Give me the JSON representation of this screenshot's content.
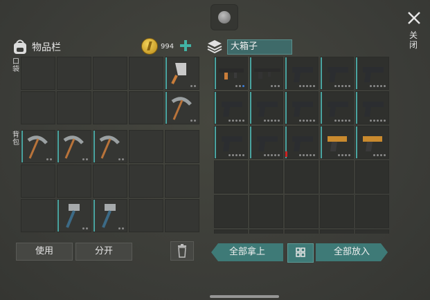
{
  "inventory": {
    "title": "物品栏",
    "coins": "994",
    "pocket_label": "口袋",
    "backpack_label": "背包"
  },
  "box": {
    "title": "大箱子"
  },
  "close_label": "关闭",
  "buttons": {
    "use": "使用",
    "split": "分开",
    "take_all": "全部拿上",
    "put_all": "全部放入"
  },
  "colors": {
    "accent": "#3e7a77",
    "bar": "#4aa4a0",
    "coin": "#e2b93b"
  },
  "icons": {
    "trash": "trash-icon",
    "grid": "grid-icon",
    "close": "close-icon",
    "coin": "coin-icon",
    "bag": "backpack-icon",
    "box": "box-icon"
  },
  "items": {
    "pocket": [
      "",
      "",
      "",
      "",
      "cleaver",
      "",
      "",
      "",
      "",
      "pickaxe"
    ],
    "backpack": [
      "pickaxe",
      "pickaxe",
      "pickaxe",
      "",
      "",
      "",
      "",
      "",
      "",
      "",
      "",
      "hammer",
      "hammer",
      "",
      ""
    ],
    "box": [
      "assault-rifle",
      "rifle",
      "pistol",
      "pistol",
      "pistol",
      "pistol",
      "pistol",
      "pistol",
      "pistol",
      "pistol",
      "pistol",
      "pistol",
      "pistol",
      "flare-gun",
      "flare-gun",
      "",
      "",
      "",
      "",
      "",
      "",
      "",
      "",
      "",
      "",
      "",
      "",
      "",
      "",
      ""
    ]
  }
}
